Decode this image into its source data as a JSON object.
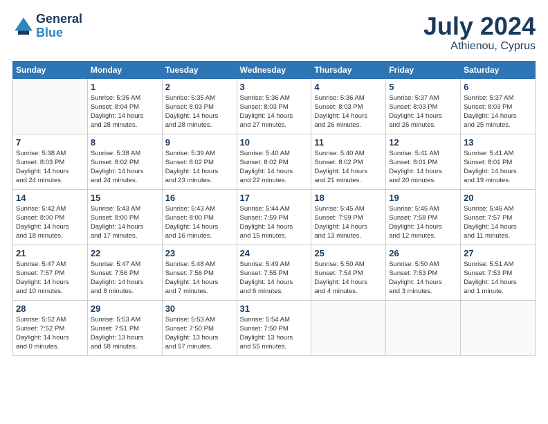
{
  "header": {
    "logo_line1": "General",
    "logo_line2": "Blue",
    "month_year": "July 2024",
    "location": "Athienou, Cyprus"
  },
  "weekdays": [
    "Sunday",
    "Monday",
    "Tuesday",
    "Wednesday",
    "Thursday",
    "Friday",
    "Saturday"
  ],
  "weeks": [
    [
      {
        "day": "",
        "info": ""
      },
      {
        "day": "1",
        "info": "Sunrise: 5:35 AM\nSunset: 8:04 PM\nDaylight: 14 hours\nand 28 minutes."
      },
      {
        "day": "2",
        "info": "Sunrise: 5:35 AM\nSunset: 8:03 PM\nDaylight: 14 hours\nand 28 minutes."
      },
      {
        "day": "3",
        "info": "Sunrise: 5:36 AM\nSunset: 8:03 PM\nDaylight: 14 hours\nand 27 minutes."
      },
      {
        "day": "4",
        "info": "Sunrise: 5:36 AM\nSunset: 8:03 PM\nDaylight: 14 hours\nand 26 minutes."
      },
      {
        "day": "5",
        "info": "Sunrise: 5:37 AM\nSunset: 8:03 PM\nDaylight: 14 hours\nand 26 minutes."
      },
      {
        "day": "6",
        "info": "Sunrise: 5:37 AM\nSunset: 8:03 PM\nDaylight: 14 hours\nand 25 minutes."
      }
    ],
    [
      {
        "day": "7",
        "info": "Sunrise: 5:38 AM\nSunset: 8:03 PM\nDaylight: 14 hours\nand 24 minutes."
      },
      {
        "day": "8",
        "info": "Sunrise: 5:38 AM\nSunset: 8:02 PM\nDaylight: 14 hours\nand 24 minutes."
      },
      {
        "day": "9",
        "info": "Sunrise: 5:39 AM\nSunset: 8:02 PM\nDaylight: 14 hours\nand 23 minutes."
      },
      {
        "day": "10",
        "info": "Sunrise: 5:40 AM\nSunset: 8:02 PM\nDaylight: 14 hours\nand 22 minutes."
      },
      {
        "day": "11",
        "info": "Sunrise: 5:40 AM\nSunset: 8:02 PM\nDaylight: 14 hours\nand 21 minutes."
      },
      {
        "day": "12",
        "info": "Sunrise: 5:41 AM\nSunset: 8:01 PM\nDaylight: 14 hours\nand 20 minutes."
      },
      {
        "day": "13",
        "info": "Sunrise: 5:41 AM\nSunset: 8:01 PM\nDaylight: 14 hours\nand 19 minutes."
      }
    ],
    [
      {
        "day": "14",
        "info": "Sunrise: 5:42 AM\nSunset: 8:00 PM\nDaylight: 14 hours\nand 18 minutes."
      },
      {
        "day": "15",
        "info": "Sunrise: 5:43 AM\nSunset: 8:00 PM\nDaylight: 14 hours\nand 17 minutes."
      },
      {
        "day": "16",
        "info": "Sunrise: 5:43 AM\nSunset: 8:00 PM\nDaylight: 14 hours\nand 16 minutes."
      },
      {
        "day": "17",
        "info": "Sunrise: 5:44 AM\nSunset: 7:59 PM\nDaylight: 14 hours\nand 15 minutes."
      },
      {
        "day": "18",
        "info": "Sunrise: 5:45 AM\nSunset: 7:59 PM\nDaylight: 14 hours\nand 13 minutes."
      },
      {
        "day": "19",
        "info": "Sunrise: 5:45 AM\nSunset: 7:58 PM\nDaylight: 14 hours\nand 12 minutes."
      },
      {
        "day": "20",
        "info": "Sunrise: 5:46 AM\nSunset: 7:57 PM\nDaylight: 14 hours\nand 11 minutes."
      }
    ],
    [
      {
        "day": "21",
        "info": "Sunrise: 5:47 AM\nSunset: 7:57 PM\nDaylight: 14 hours\nand 10 minutes."
      },
      {
        "day": "22",
        "info": "Sunrise: 5:47 AM\nSunset: 7:56 PM\nDaylight: 14 hours\nand 8 minutes."
      },
      {
        "day": "23",
        "info": "Sunrise: 5:48 AM\nSunset: 7:56 PM\nDaylight: 14 hours\nand 7 minutes."
      },
      {
        "day": "24",
        "info": "Sunrise: 5:49 AM\nSunset: 7:55 PM\nDaylight: 14 hours\nand 6 minutes."
      },
      {
        "day": "25",
        "info": "Sunrise: 5:50 AM\nSunset: 7:54 PM\nDaylight: 14 hours\nand 4 minutes."
      },
      {
        "day": "26",
        "info": "Sunrise: 5:50 AM\nSunset: 7:53 PM\nDaylight: 14 hours\nand 3 minutes."
      },
      {
        "day": "27",
        "info": "Sunrise: 5:51 AM\nSunset: 7:53 PM\nDaylight: 14 hours\nand 1 minute."
      }
    ],
    [
      {
        "day": "28",
        "info": "Sunrise: 5:52 AM\nSunset: 7:52 PM\nDaylight: 14 hours\nand 0 minutes."
      },
      {
        "day": "29",
        "info": "Sunrise: 5:53 AM\nSunset: 7:51 PM\nDaylight: 13 hours\nand 58 minutes."
      },
      {
        "day": "30",
        "info": "Sunrise: 5:53 AM\nSunset: 7:50 PM\nDaylight: 13 hours\nand 57 minutes."
      },
      {
        "day": "31",
        "info": "Sunrise: 5:54 AM\nSunset: 7:50 PM\nDaylight: 13 hours\nand 55 minutes."
      },
      {
        "day": "",
        "info": ""
      },
      {
        "day": "",
        "info": ""
      },
      {
        "day": "",
        "info": ""
      }
    ]
  ]
}
